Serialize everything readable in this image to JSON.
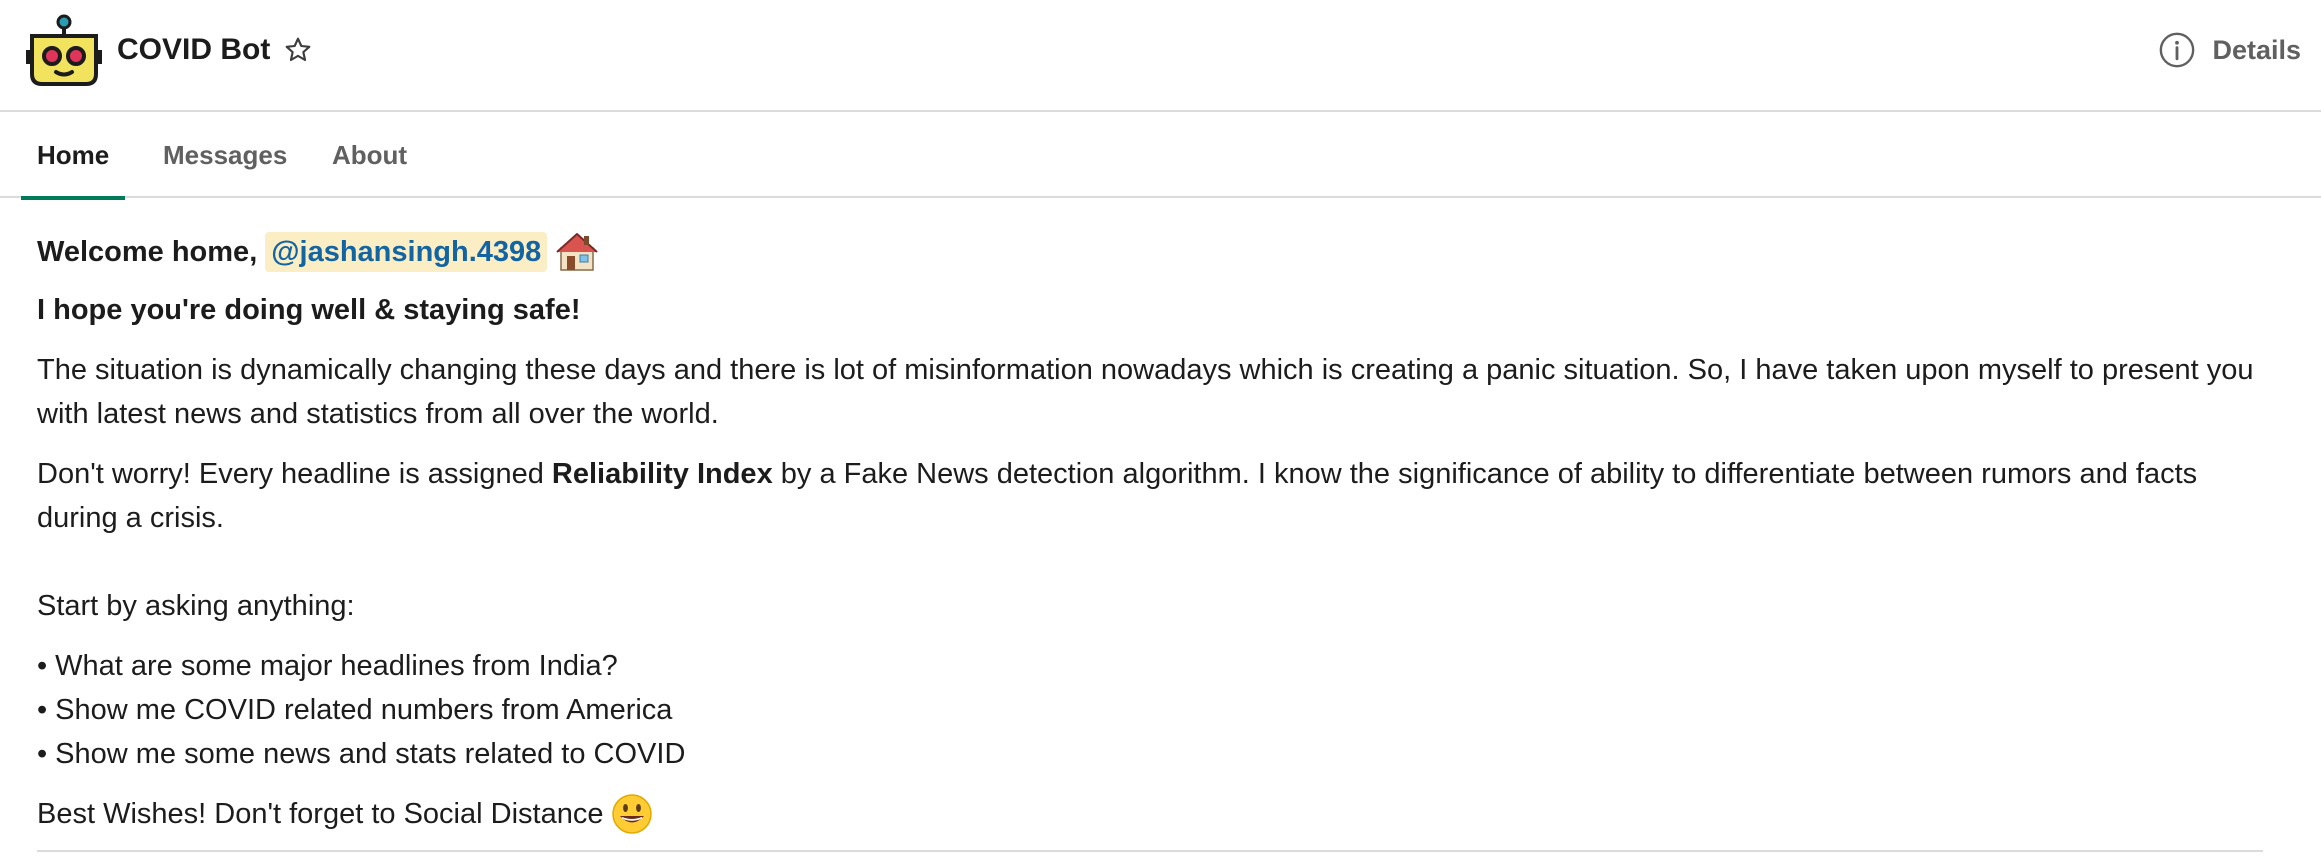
{
  "header": {
    "bot_name": "COVID Bot",
    "avatar_icon": "robot-avatar-icon",
    "star_icon": "star-outline-icon",
    "details_icon": "info-circle-icon",
    "details_label": "Details"
  },
  "tabs": [
    {
      "label": "Home",
      "active": true
    },
    {
      "label": "Messages",
      "active": false
    },
    {
      "label": "About",
      "active": false
    }
  ],
  "home": {
    "welcome_prefix": "Welcome home,",
    "mention": "@jashansingh.4398",
    "welcome_emoji": "house-emoji",
    "subtitle": "I hope you're doing well & staying safe!",
    "paragraph1": "The situation is dynamically changing these days and there is lot of misinformation nowadays which is creating a panic situation. So, I have taken upon myself to present you with latest news and statistics from all over the world.",
    "paragraph2_prefix": "Don't worry! Every headline is assigned",
    "paragraph2_bold": "Reliability Index",
    "paragraph2_suffix": "by a Fake News detection algorithm. I know the significance of ability to differentiate between rumors and facts during a crisis.",
    "start_prompt": "Start by asking anything:",
    "bullet_char": "•",
    "examples": [
      "What are some major headlines from India?",
      "Show me COVID related numbers from America",
      "Show me some news and stats related to COVID"
    ],
    "closing": "Best Wishes! Don't forget to Social Distance",
    "closing_emoji": "smiley-emoji"
  },
  "colors": {
    "accent_tab_underline": "#007a5a",
    "mention_bg": "#fbeec5",
    "mention_text": "#1264a3",
    "robot_yellow": "#f2e35f",
    "robot_eye_red": "#e0345a",
    "robot_antenna_teal": "#2a9db5"
  }
}
